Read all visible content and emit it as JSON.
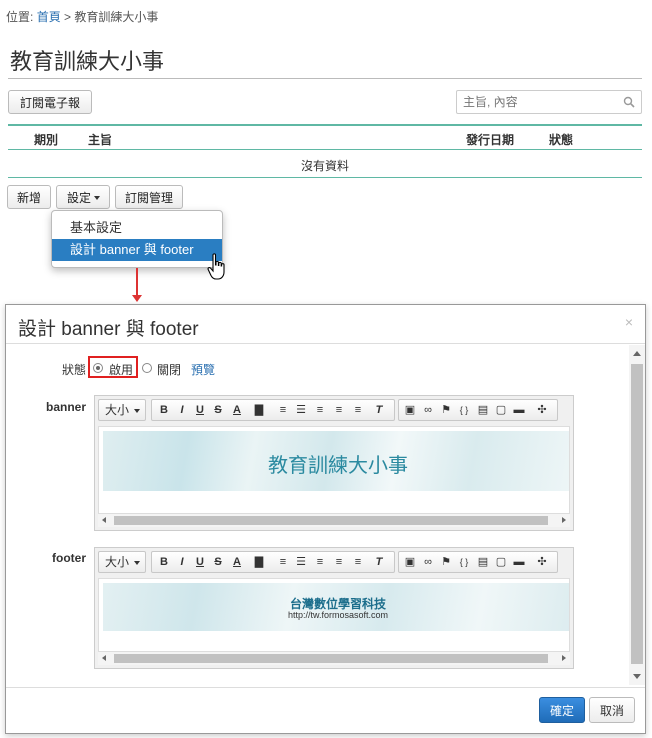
{
  "breadcrumb": {
    "prefix": "位置:",
    "home": "首頁",
    "sep": ">",
    "current": "教育訓練大小事"
  },
  "page": {
    "title": "教育訓練大小事"
  },
  "toolbar": {
    "subscribe_label": "訂閱電子報",
    "search_placeholder": "主旨, 內容"
  },
  "table": {
    "columns": [
      "期別",
      "主旨",
      "發行日期",
      "狀態"
    ],
    "empty_text": "沒有資料"
  },
  "actions": {
    "add_label": "新增",
    "settings_label": "設定",
    "subscription_manage_label": "訂閱管理"
  },
  "settings_menu": {
    "items": [
      {
        "label": "基本設定",
        "active": false
      },
      {
        "label": "設計 banner 與 footer",
        "active": true
      }
    ]
  },
  "modal": {
    "title": "設計 banner 與 footer",
    "close_glyph": "×",
    "status_label": "狀態",
    "status_options": [
      {
        "label": "啟用",
        "checked": true
      },
      {
        "label": "關閉",
        "checked": false
      }
    ],
    "preview_label": "預覽",
    "banner_label": "banner",
    "footer_label": "footer",
    "font_size_label": "大小",
    "banner_image_text": "教育訓練大小事",
    "footer_image_title": "台灣數位學習科技",
    "footer_image_url": "http://tw.formosasoft.com",
    "ok_label": "確定",
    "cancel_label": "取消"
  },
  "editor_tools": [
    "B",
    "I",
    "U",
    "S",
    "A",
    "bg",
    "ol",
    "ul",
    "align-left",
    "align-center",
    "align-right",
    "Tx",
    "image",
    "link",
    "flag",
    "code",
    "save",
    "template",
    "folder",
    "fullscreen"
  ],
  "colors": {
    "accent": "#2a7ec2",
    "table_rule": "#5fb8a4",
    "highlight": "#e02020",
    "link": "#2a6fb0"
  }
}
